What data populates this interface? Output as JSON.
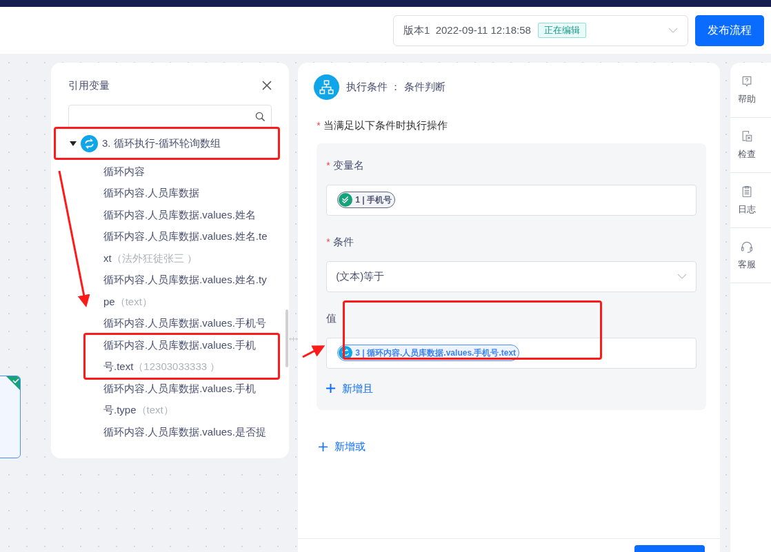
{
  "header": {
    "version_select": {
      "value": "版本1  2022-09-11 12:18:58",
      "badge": "正在编辑"
    },
    "publish_button": "发布流程"
  },
  "variable_panel": {
    "title": "引用变量",
    "tree": [
      {
        "label": "3. 循环执行-循环轮询数组",
        "expanded": true,
        "annotated": true,
        "children": [
          {
            "label": "循环内容",
            "annotated": false
          },
          {
            "label": "循环内容.人员库数据",
            "annotated": false
          },
          {
            "label": "循环内容.人员库数据.values.姓名",
            "annotated": false
          },
          {
            "label": "循环内容.人员库数据.values.姓名.text",
            "value": "（法外狂徒张三 ）",
            "annotated": false
          },
          {
            "label": "循环内容.人员库数据.values.姓名.type",
            "value": "（text）",
            "annotated": false
          },
          {
            "label": "循环内容.人员库数据.values.手机号",
            "annotated": false
          },
          {
            "label": "循环内容.人员库数据.values.手机号.text",
            "value": "（12303033333 ）",
            "annotated": true
          },
          {
            "label": "循环内容.人员库数据.values.手机号.type",
            "value": "（text）",
            "annotated": false
          },
          {
            "label": "循环内容.人员库数据.values.是否提",
            "annotated": false
          }
        ]
      }
    ]
  },
  "condition_panel": {
    "title": "执行条件 ： 条件判断",
    "section_required_mark": "*",
    "section_label": "当满足以下条件时执行操作",
    "fields": [
      {
        "kind": "tag",
        "label": "变量名",
        "required_mark": "*",
        "annotated": false,
        "tag": {
          "kind": "check",
          "text": "1 | 手机号"
        }
      },
      {
        "kind": "select",
        "label": "条件",
        "required_mark": "*",
        "annotated": false,
        "value": "(文本)等于"
      },
      {
        "kind": "tag",
        "label": "值",
        "annotated": true,
        "tag": {
          "kind": "loop",
          "text": "3 | 循环内容.人员库数据.values.手机号.text"
        }
      }
    ],
    "add_and": "新增且",
    "add_or": "新增或"
  },
  "right_sidebar": [
    {
      "kind": "help",
      "label": "帮助"
    },
    {
      "kind": "check",
      "label": "检查"
    },
    {
      "kind": "log",
      "label": "日志"
    },
    {
      "kind": "service",
      "label": "客服"
    }
  ]
}
